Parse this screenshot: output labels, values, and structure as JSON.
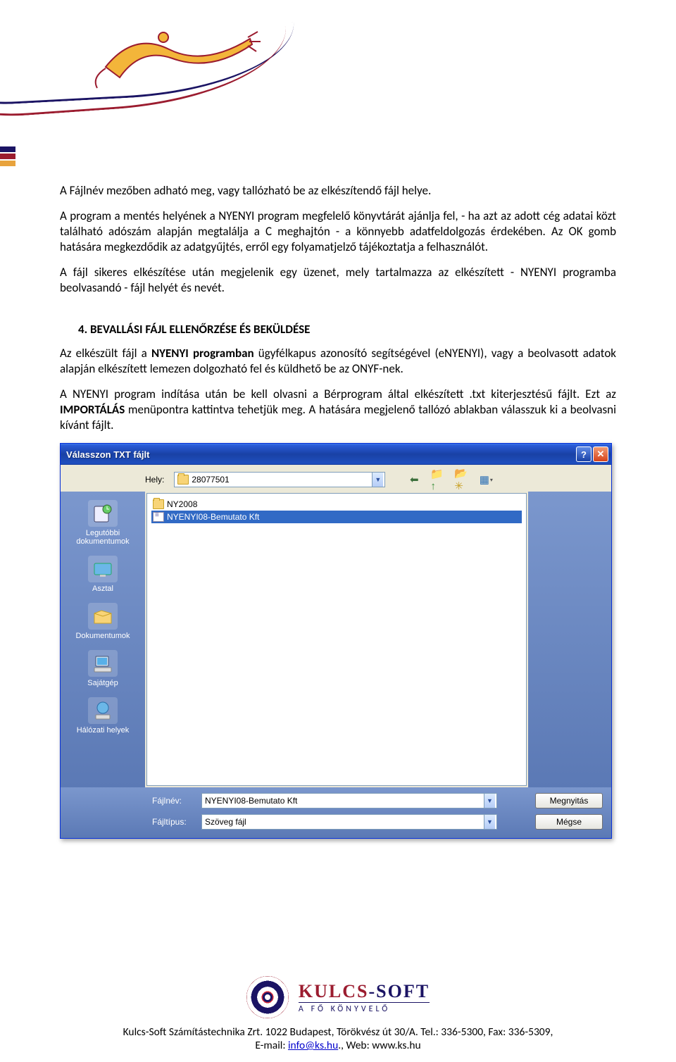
{
  "doc": {
    "p1": "A Fájlnév mezőben adható meg, vagy tallózható be az elkészítendő fájl helye.",
    "p2": "A program a mentés helyének a NYENYI program megfelelő könyvtárát ajánlja fel, - ha azt az adott cég adatai közt található adószám alapján megtalálja a C meghajtón - a könnyebb adatfeldolgozás érdekében. Az OK gomb hatására megkezdődik az adatgyűjtés, erről egy folyamatjelző tájékoztatja a felhasználót.",
    "p3": "A fájl sikeres elkészítése után megjelenik egy üzenet, mely tartalmazza az elkészített - NYENYI programba beolvasandó - fájl helyét és nevét.",
    "section4_title": "4.   BEVALLÁSI FÁJL ELLENŐRZÉSE ÉS BEKÜLDÉSE",
    "p4a_pre": "Az elkészült fájl a ",
    "p4a_bold": "NYENYI programban",
    "p4a_post": " ügyfélkapus azonosító segítségével (eNYENYI), vagy a beolvasott adatok alapján elkészített lemezen dolgozható fel és küldhető be az ONYF-nek.",
    "p4b_pre": "A NYENYI program indítása után be kell olvasni a Bérprogram által elkészített .txt kiterjesztésű fájlt. Ezt az ",
    "p4b_bold": "IMPORTÁLÁS",
    "p4b_post": " menüpontra kattintva tehetjük meg. A hatására megjelenő tallózó ablakban válasszuk ki a beolvasni kívánt fájlt."
  },
  "dialog": {
    "title": "Válasszon TXT fájlt",
    "hely_label": "Hely:",
    "hely_value": "28077501",
    "places": [
      {
        "label": "Legutóbbi dokumentumok"
      },
      {
        "label": "Asztal"
      },
      {
        "label": "Dokumentumok"
      },
      {
        "label": "Sajátgép"
      },
      {
        "label": "Hálózati helyek"
      }
    ],
    "files": [
      {
        "name": "NY2008",
        "type": "folder",
        "selected": false
      },
      {
        "name": "NYENYI08-Bemutato Kft",
        "type": "doc",
        "selected": true
      }
    ],
    "filename_label": "Fájlnév:",
    "filename_value": "NYENYI08-Bemutato Kft",
    "filetype_label": "Fájltípus:",
    "filetype_value": "Szöveg fájl",
    "open_btn": "Megnyitás",
    "cancel_btn": "Mégse"
  },
  "footer": {
    "brand1a": "KULCS",
    "brand1b": "-SOFT",
    "brand2": "A FŐ KÖNYVELŐ",
    "line_pre": "Kulcs-Soft Számítástechnika Zrt. 1022 Budapest, Törökvész út 30/A. Tel.: 336-5300, Fax: 336-5309,",
    "line2_pre": "E-mail: ",
    "email": "info@ks.hu",
    "line2_mid": "., Web: ",
    "web": "www.ks.hu"
  }
}
